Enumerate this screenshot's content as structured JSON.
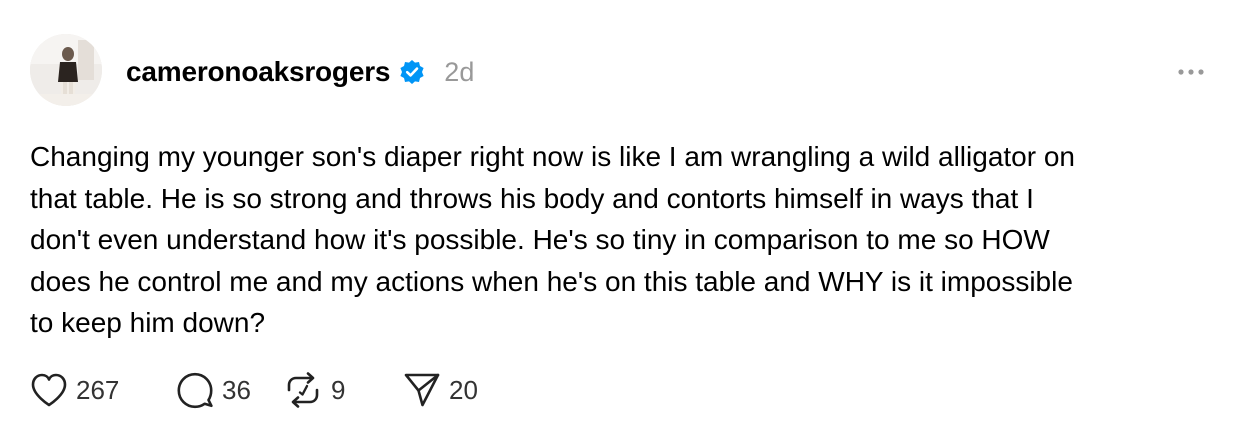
{
  "post": {
    "username": "cameronoaksrogers",
    "time_ago": "2d",
    "text": "Changing my younger son's diaper right now is like I am wrangling a wild alligator on\nthat table. He is so strong and throws his body and contorts himself in ways that I\ndon't even understand how it's possible. He's so tiny in comparison to me so HOW\ndoes he control me and my actions when he's on this table and WHY is it impossible\nto keep him down?",
    "verified_icon": "verified-badge-icon",
    "more_icon": "more-options-icon"
  },
  "actions": {
    "likes": "267",
    "replies": "36",
    "reposts": "9",
    "shares": "20"
  },
  "colors": {
    "verified": "#0095F6",
    "muted": "#999999"
  }
}
